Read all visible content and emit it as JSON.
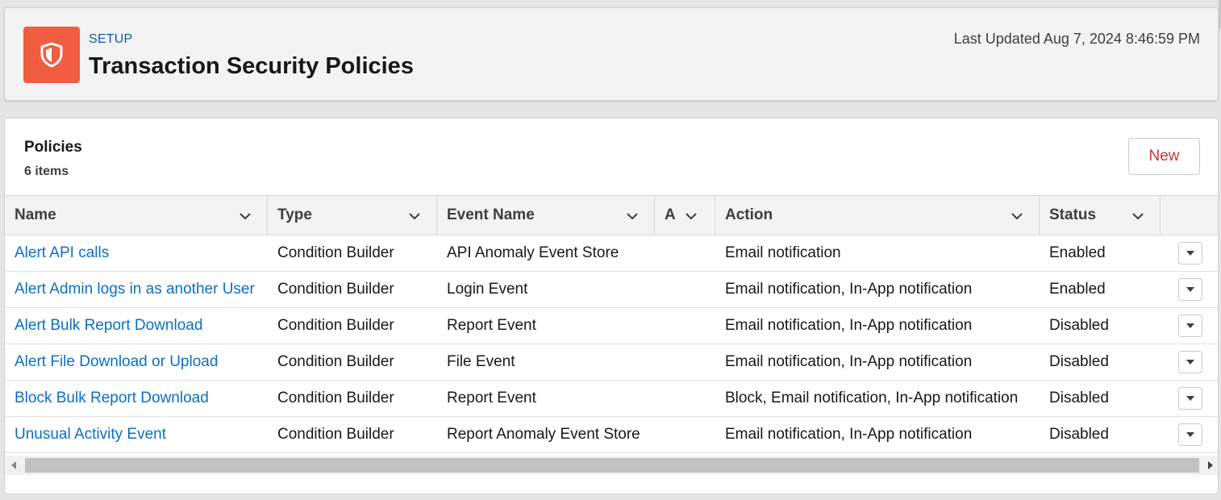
{
  "header": {
    "setup_label": "SETUP",
    "title": "Transaction Security Policies",
    "last_updated": "Last Updated Aug 7, 2024 8:46:59 PM",
    "icon": "shield-icon",
    "icon_bg": "#f15d40"
  },
  "policies": {
    "title": "Policies",
    "count": "6 items",
    "new_label": "New",
    "new_color": "#c23934"
  },
  "table": {
    "columns": [
      "Name",
      "Type",
      "Event Name",
      "A",
      "Action",
      "Status"
    ],
    "rows": [
      {
        "name": "Alert API calls",
        "type": "Condition Builder",
        "event": "API Anomaly Event Store",
        "a": "",
        "action": "Email notification",
        "status": "Enabled"
      },
      {
        "name": "Alert Admin logs in as another User",
        "type": "Condition Builder",
        "event": "Login Event",
        "a": "",
        "action": "Email notification, In-App notification",
        "status": "Enabled"
      },
      {
        "name": "Alert Bulk Report Download",
        "type": "Condition Builder",
        "event": "Report Event",
        "a": "",
        "action": "Email notification, In-App notification",
        "status": "Disabled"
      },
      {
        "name": "Alert File Download or Upload",
        "type": "Condition Builder",
        "event": "File Event",
        "a": "",
        "action": "Email notification, In-App notification",
        "status": "Disabled"
      },
      {
        "name": "Block Bulk Report Download",
        "type": "Condition Builder",
        "event": "Report Event",
        "a": "",
        "action": "Block, Email notification, In-App notification",
        "status": "Disabled"
      },
      {
        "name": "Unusual Activity Event",
        "type": "Condition Builder",
        "event": "Report Anomaly Event Store",
        "a": "",
        "action": "Email notification, In-App notification",
        "status": "Disabled"
      }
    ],
    "link_color": "#0b6fc4"
  }
}
